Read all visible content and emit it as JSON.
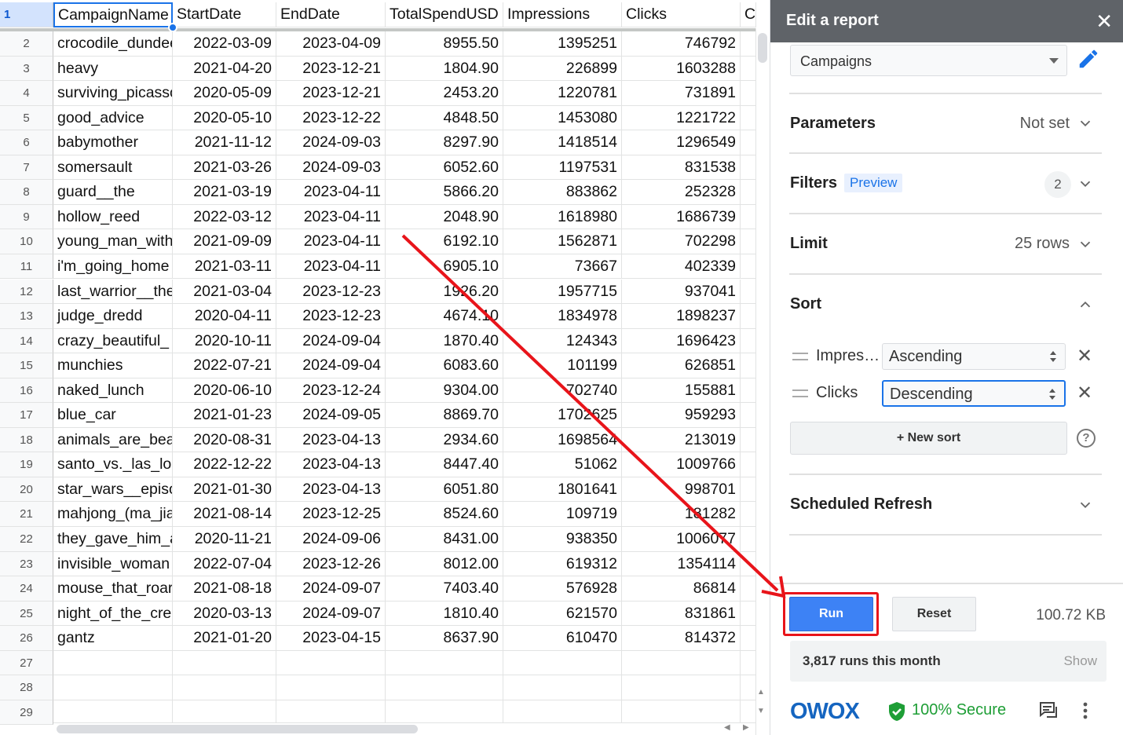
{
  "sheet": {
    "header_row_number": "1",
    "columns": [
      "CampaignName",
      "StartDate",
      "EndDate",
      "TotalSpendUSD",
      "Impressions",
      "Clicks",
      "C"
    ],
    "rows": [
      {
        "n": "2",
        "cells": [
          "crocodile_dundee",
          "2022-03-09",
          "2023-04-09",
          "8955.50",
          "1395251",
          "746792"
        ]
      },
      {
        "n": "3",
        "cells": [
          "heavy",
          "2021-04-20",
          "2023-12-21",
          "1804.90",
          "226899",
          "1603288"
        ]
      },
      {
        "n": "4",
        "cells": [
          "surviving_picasso",
          "2020-05-09",
          "2023-12-21",
          "2453.20",
          "1220781",
          "731891"
        ]
      },
      {
        "n": "5",
        "cells": [
          "good_advice",
          "2020-05-10",
          "2023-12-22",
          "4848.50",
          "1453080",
          "1221722"
        ]
      },
      {
        "n": "6",
        "cells": [
          "babymother",
          "2021-11-12",
          "2024-09-03",
          "8297.90",
          "1418514",
          "1296549"
        ]
      },
      {
        "n": "7",
        "cells": [
          "somersault",
          "2021-03-26",
          "2024-09-03",
          "6052.60",
          "1197531",
          "831538"
        ]
      },
      {
        "n": "8",
        "cells": [
          "guard__the",
          "2021-03-19",
          "2023-04-11",
          "5866.20",
          "883862",
          "252328"
        ]
      },
      {
        "n": "9",
        "cells": [
          "hollow_reed",
          "2022-03-12",
          "2023-04-11",
          "2048.90",
          "1618980",
          "1686739"
        ]
      },
      {
        "n": "10",
        "cells": [
          "young_man_with",
          "2021-09-09",
          "2023-04-11",
          "6192.10",
          "1562871",
          "702298"
        ]
      },
      {
        "n": "11",
        "cells": [
          "i'm_going_home",
          "2021-03-11",
          "2023-04-11",
          "6905.10",
          "73667",
          "402339"
        ]
      },
      {
        "n": "12",
        "cells": [
          "last_warrior__the",
          "2021-03-04",
          "2023-12-23",
          "1926.20",
          "1957715",
          "937041"
        ]
      },
      {
        "n": "13",
        "cells": [
          "judge_dredd",
          "2020-04-11",
          "2023-12-23",
          "4674.10",
          "1834978",
          "1898237"
        ]
      },
      {
        "n": "14",
        "cells": [
          "crazy_beautiful_",
          "2020-10-11",
          "2024-09-04",
          "1870.40",
          "124343",
          "1696423"
        ]
      },
      {
        "n": "15",
        "cells": [
          "munchies",
          "2022-07-21",
          "2024-09-04",
          "6083.60",
          "101199",
          "626851"
        ]
      },
      {
        "n": "16",
        "cells": [
          "naked_lunch",
          "2020-06-10",
          "2023-12-24",
          "9304.00",
          "702740",
          "155881"
        ]
      },
      {
        "n": "17",
        "cells": [
          "blue_car",
          "2021-01-23",
          "2024-09-05",
          "8869.70",
          "1702625",
          "959293"
        ]
      },
      {
        "n": "18",
        "cells": [
          "animals_are_beautiful",
          "2020-08-31",
          "2023-04-13",
          "2934.60",
          "1698564",
          "213019"
        ]
      },
      {
        "n": "19",
        "cells": [
          "santo_vs._las_lobas",
          "2022-12-22",
          "2023-04-13",
          "8447.40",
          "51062",
          "1009766"
        ]
      },
      {
        "n": "20",
        "cells": [
          "star_wars__episode",
          "2021-01-30",
          "2023-04-13",
          "6051.80",
          "1801641",
          "998701"
        ]
      },
      {
        "n": "21",
        "cells": [
          "mahjong_(ma_jiang)",
          "2021-08-14",
          "2023-12-25",
          "8524.60",
          "109719",
          "181282"
        ]
      },
      {
        "n": "22",
        "cells": [
          "they_gave_him_a_gun",
          "2020-11-21",
          "2024-09-06",
          "8431.00",
          "938350",
          "1006077"
        ]
      },
      {
        "n": "23",
        "cells": [
          "invisible_woman",
          "2022-07-04",
          "2023-12-26",
          "8012.00",
          "619312",
          "1354114"
        ]
      },
      {
        "n": "24",
        "cells": [
          "mouse_that_roared",
          "2021-08-18",
          "2024-09-07",
          "7403.40",
          "576928",
          "86814"
        ]
      },
      {
        "n": "25",
        "cells": [
          "night_of_the_creeps",
          "2020-03-13",
          "2024-09-07",
          "1810.40",
          "621570",
          "831861"
        ]
      },
      {
        "n": "26",
        "cells": [
          "gantz",
          "2021-01-20",
          "2023-04-15",
          "8637.90",
          "610470",
          "814372"
        ]
      },
      {
        "n": "27",
        "cells": [
          "",
          "",
          "",
          "",
          "",
          ""
        ]
      },
      {
        "n": "28",
        "cells": [
          "",
          "",
          "",
          "",
          "",
          ""
        ]
      },
      {
        "n": "29",
        "cells": [
          "",
          "",
          "",
          "",
          "",
          ""
        ]
      }
    ]
  },
  "sidebar": {
    "title": "Edit a report",
    "close_glyph": "✕",
    "source_select": "Campaigns",
    "parameters": {
      "label": "Parameters",
      "value": "Not set"
    },
    "filters": {
      "label": "Filters",
      "badge": "Preview",
      "count": "2"
    },
    "limit": {
      "label": "Limit",
      "value": "25 rows"
    },
    "sort": {
      "label": "Sort",
      "items": [
        {
          "field": "Impres…",
          "direction": "Ascending"
        },
        {
          "field": "Clicks",
          "direction": "Descending"
        }
      ],
      "new_sort_label": "+ New sort",
      "help_glyph": "?"
    },
    "scheduled_refresh": {
      "label": "Scheduled Refresh"
    },
    "run_label": "Run",
    "reset_label": "Reset",
    "file_size": "100.72 KB",
    "runs_text": "3,817 runs this month",
    "runs_show": "Show",
    "brand": "OWOX",
    "secure_text": "100% Secure",
    "colors": {
      "accent": "#1a73e8",
      "run": "#3d82f5",
      "highlight": "#e8141a",
      "secure": "#1e9e36",
      "brand": "#1565c0"
    }
  }
}
